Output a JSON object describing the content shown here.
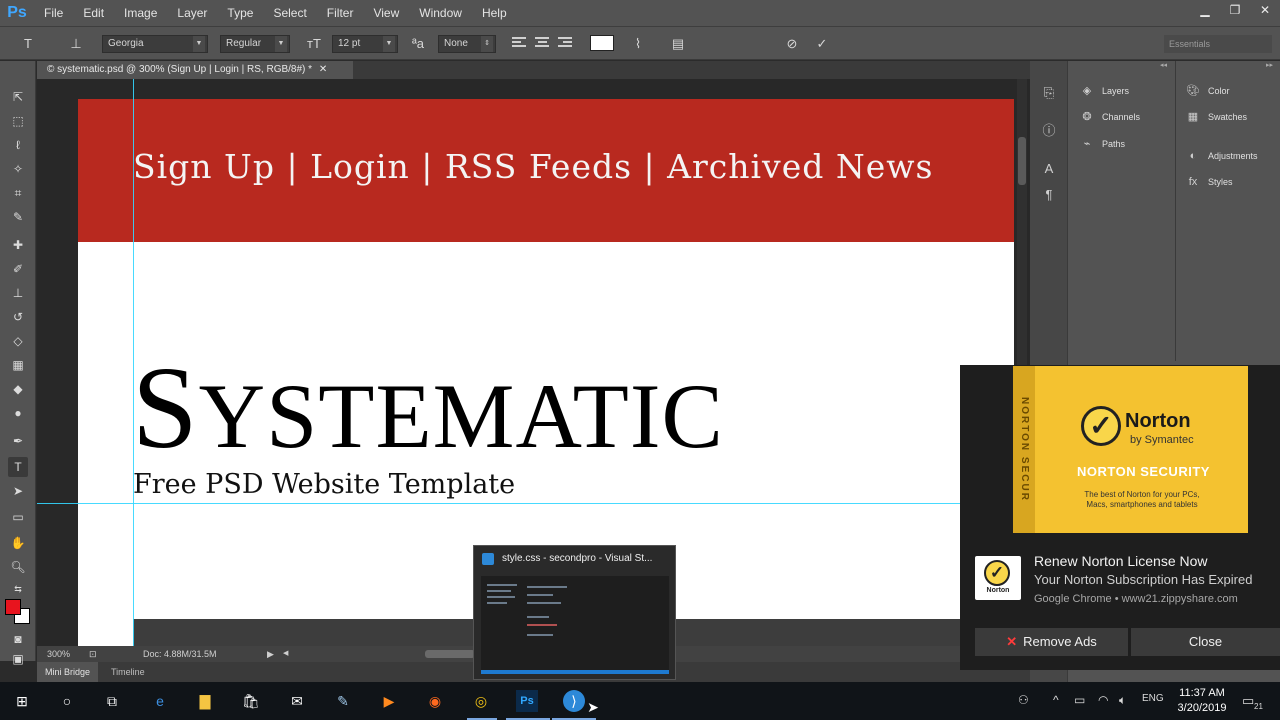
{
  "app": {
    "logo": "Ps",
    "menu": [
      "File",
      "Edit",
      "Image",
      "Layer",
      "Type",
      "Select",
      "Filter",
      "View",
      "Window",
      "Help"
    ]
  },
  "options_bar": {
    "font_family": "Georgia",
    "font_style": "Regular",
    "font_size": "12 pt",
    "antialias": "None",
    "workspace": "Essentials"
  },
  "document": {
    "tab_title": "© systematic.psd @ 300% (Sign Up | Login | RS, RGB/8#) *",
    "header_nav": "Sign Up | Login | RSS Feeds | Archived News",
    "title_first": "S",
    "title_rest": "YSTEMATIC",
    "subtitle": "Free PSD Website Template",
    "header_color": "#b8291f"
  },
  "status": {
    "zoom": "300%",
    "doc_size": "Doc: 4.88M/31.5M"
  },
  "bottom_tabs": [
    "Mini Bridge",
    "Timeline"
  ],
  "panels": {
    "col1": [
      "Layers",
      "Channels",
      "Paths"
    ],
    "col2_top": [
      "Color",
      "Swatches"
    ],
    "col2_bottom": [
      "Adjustments",
      "Styles"
    ]
  },
  "norton": {
    "side_text": "NORTON SECUR",
    "brand": "Norton",
    "by": "by Symantec",
    "product": "NORTON SECURITY",
    "tagline": "The best of Norton for your PCs, Macs, smartphones and tablets",
    "icon_label": "Norton",
    "notif_title": "Renew Norton License Now",
    "notif_body": "Your Norton Subscription Has Expired",
    "notif_source": "Google Chrome • www21.zippyshare.com",
    "remove_ads": "Remove Ads",
    "close": "Close"
  },
  "thumbnail": {
    "title": "style.css - secondpro - Visual St..."
  },
  "taskbar": {
    "time": "11:37 AM",
    "date": "3/20/2019",
    "lang": "ENG",
    "notif_count": "21"
  }
}
